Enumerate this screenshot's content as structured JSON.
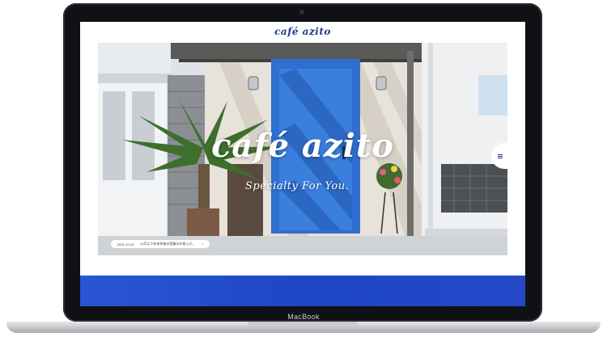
{
  "device": {
    "brand_label": "MacBook"
  },
  "site": {
    "logo": "café azito",
    "hero_title": "café azito",
    "tagline": "Specialty For You.",
    "news": {
      "date": "2021.12.10",
      "text": "12月より年末年始の営業のお知らせ。"
    }
  },
  "icons": {
    "menu": "hamburger-menu-icon",
    "news_arrow": "chevron-right-icon"
  },
  "colors": {
    "accent_blue": "#1f46c8",
    "door_blue": "#2f73d2",
    "logo_blue": "#1f3a8a"
  }
}
